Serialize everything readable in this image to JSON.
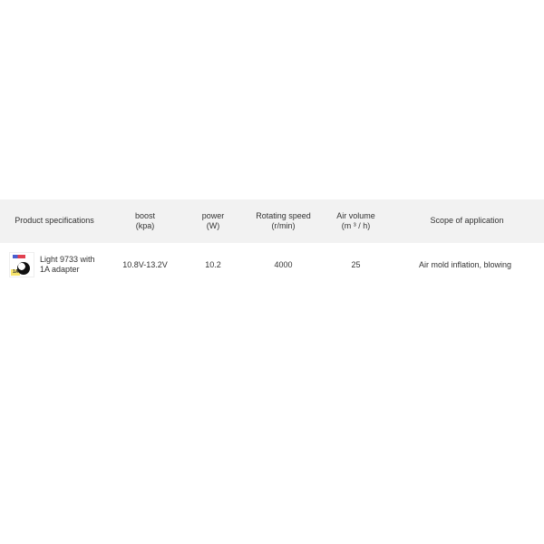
{
  "table": {
    "headers": {
      "spec": "Product specifications",
      "boost_label": "boost",
      "boost_unit": "(kpa)",
      "power_label": "power",
      "power_unit": "(W)",
      "rot_label": "Rotating speed",
      "rot_unit": "(r/min)",
      "air_label": "Air volume",
      "air_unit": "(m ³ / h)",
      "scope": "Scope of application"
    },
    "rows": [
      {
        "image_badge": "1A",
        "name_line1": "Light 9733 with",
        "name_line2": "1A adapter",
        "boost": "10.8V-13.2V",
        "power": "10.2",
        "rot": "4000",
        "air": "25",
        "scope": "Air mold inflation, blowing"
      }
    ]
  }
}
